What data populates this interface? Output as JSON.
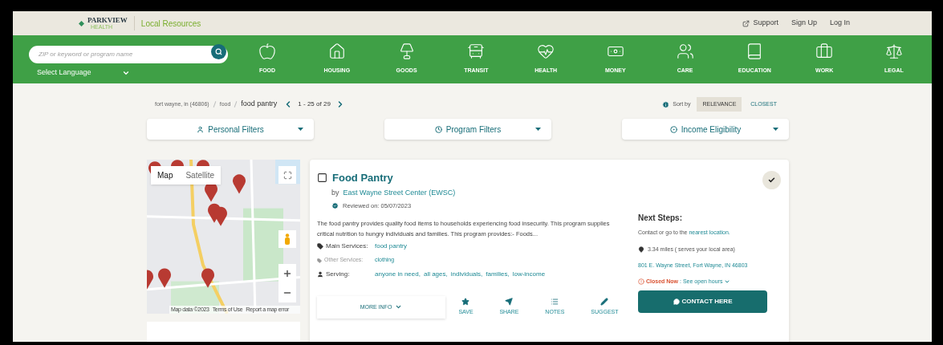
{
  "header": {
    "logo": {
      "name": "PARKVIEW",
      "sub": "HEALTH"
    },
    "site_title": "Local Resources",
    "links": [
      {
        "label": "Support",
        "kind": "external"
      },
      {
        "label": "Sign Up",
        "kind": "plain"
      },
      {
        "label": "Log In",
        "kind": "plain"
      }
    ]
  },
  "search": {
    "placeholder": "ZIP or keyword or program name"
  },
  "language": {
    "label": "Select Language"
  },
  "categories": [
    {
      "label": "FOOD",
      "kind": "apple"
    },
    {
      "label": "HOUSING",
      "kind": "house"
    },
    {
      "label": "GOODS",
      "kind": "lamp"
    },
    {
      "label": "TRANSIT",
      "kind": "bus"
    },
    {
      "label": "HEALTH",
      "kind": "heart"
    },
    {
      "label": "MONEY",
      "kind": "money"
    },
    {
      "label": "CARE",
      "kind": "people"
    },
    {
      "label": "EDUCATION",
      "kind": "book"
    },
    {
      "label": "WORK",
      "kind": "briefcase"
    },
    {
      "label": "LEGAL",
      "kind": "scale"
    }
  ],
  "breadcrumb": [
    "fort wayne, in (46806)",
    "food",
    "food pantry"
  ],
  "pagination": "1 - 25 of 29",
  "sort": {
    "label": "Sort by",
    "options": [
      {
        "label": "RELEVANCE",
        "selected": true
      },
      {
        "label": "CLOSEST",
        "selected": false
      }
    ]
  },
  "filters": [
    {
      "label": "Personal Filters",
      "kind": "person"
    },
    {
      "label": "Program Filters",
      "kind": "clock"
    },
    {
      "label": "Income Eligibility",
      "kind": "circle"
    }
  ],
  "map": {
    "modes": [
      {
        "label": "Map",
        "selected": true
      },
      {
        "label": "Satellite",
        "selected": false
      }
    ],
    "attribution": [
      "Map data ©2023",
      "Terms of Use",
      "Report a map error"
    ]
  },
  "result": {
    "title": "Food Pantry",
    "checked": false,
    "by": "by",
    "organization": "East Wayne Street Center (EWSC)",
    "reviewed": "Reviewed on: 05/07/2023",
    "description": "The food pantry provides quality food items to households experiencing food insecurity. This program supplies critical nutrition to hungry individuals and families. This program provides:- Foods...",
    "details": [
      {
        "label": "Main Services:",
        "kind": "main",
        "values": [
          "food pantry"
        ]
      },
      {
        "label": "Other Services:",
        "kind": "other",
        "values": [
          "clothing"
        ]
      },
      {
        "label": "Serving:",
        "kind": "serving",
        "values": [
          "anyone in need,",
          "all ages,",
          "individuals,",
          "families,",
          "low-income"
        ]
      }
    ],
    "more_info": "MORE INFO",
    "actions": [
      {
        "label": "SAVE",
        "kind": "star"
      },
      {
        "label": "SHARE",
        "kind": "send"
      },
      {
        "label": "NOTES",
        "kind": "list"
      },
      {
        "label": "SUGGEST",
        "kind": "pencil"
      }
    ],
    "next_steps": {
      "title": "Next Steps:",
      "contact_text": "Contact or go to the",
      "contact_link": "nearest location.",
      "distance": "3.34 miles ( serves your local area)",
      "address": "801 E. Wayne Street, Fort Wayne, IN 46803",
      "status": "Closed Now",
      "hours": ": See open hours",
      "button": "CONTACT HERE"
    }
  }
}
